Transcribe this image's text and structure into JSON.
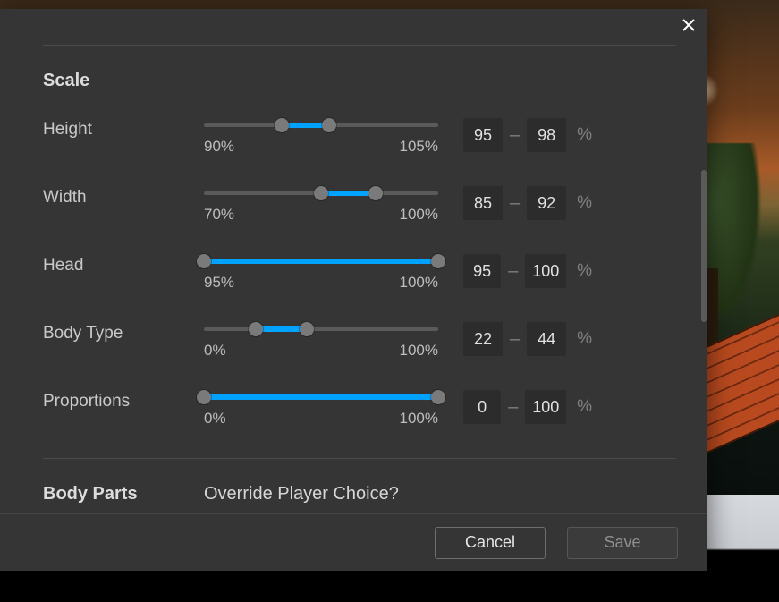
{
  "section": {
    "scale_title": "Scale",
    "body_parts_title": "Body Parts",
    "override_question": "Override Player Choice?"
  },
  "sliders": {
    "height": {
      "label": "Height",
      "track_min": 90,
      "track_max": 105,
      "lo": 95,
      "hi": 98,
      "min_label": "90%",
      "max_label": "105%",
      "unit": "%"
    },
    "width": {
      "label": "Width",
      "track_min": 70,
      "track_max": 100,
      "lo": 85,
      "hi": 92,
      "min_label": "70%",
      "max_label": "100%",
      "unit": "%"
    },
    "head": {
      "label": "Head",
      "track_min": 95,
      "track_max": 100,
      "lo": 95,
      "hi": 100,
      "min_label": "95%",
      "max_label": "100%",
      "unit": "%"
    },
    "body_type": {
      "label": "Body Type",
      "track_min": 0,
      "track_max": 100,
      "lo": 22,
      "hi": 44,
      "min_label": "0%",
      "max_label": "100%",
      "unit": "%"
    },
    "proportions": {
      "label": "Proportions",
      "track_min": 0,
      "track_max": 100,
      "lo": 0,
      "hi": 100,
      "min_label": "0%",
      "max_label": "100%",
      "unit": "%"
    }
  },
  "footer": {
    "cancel": "Cancel",
    "save": "Save"
  },
  "colors": {
    "accent": "#00a2ff",
    "panel": "#353535",
    "input_bg": "#2c2c2c"
  }
}
